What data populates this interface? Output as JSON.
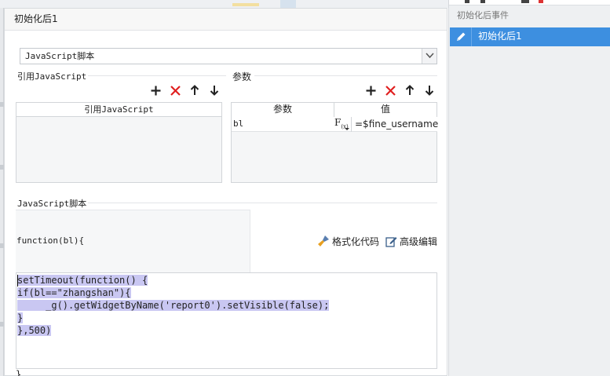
{
  "dialog": {
    "title": "初始化后1",
    "script_type": "JavaScript脚本"
  },
  "ref_js": {
    "section_label": "引用JavaScript",
    "column_header": "引用JavaScript",
    "toolbar": {
      "add": "add-icon",
      "delete": "delete-icon",
      "up": "arrow-up-icon",
      "down": "arrow-down-icon"
    }
  },
  "params": {
    "section_label": "参数",
    "columns": [
      "参数",
      "值"
    ],
    "rows": [
      {
        "name": "bl",
        "formula_button": "F(x)",
        "value": "=$fine_username"
      }
    ]
  },
  "script": {
    "section_label": "JavaScript脚本",
    "signature": "function(bl){",
    "format_label": "格式化代码",
    "advanced_label": "高级编辑",
    "code_lines": [
      "setTimeout(function() {",
      "if(bl==\"zhangshan\"){",
      "     _g().getWidgetByName('report0').setVisible(false);",
      "}",
      "},500)"
    ],
    "closing_brace": "}"
  },
  "event_panel": {
    "header": "初始化后事件",
    "items": [
      {
        "label": "初始化后1",
        "selected": true
      }
    ]
  },
  "colors": {
    "accent": "#3d8fe0",
    "delete_red": "#e02020",
    "code_highlight": "#c9c7f2",
    "keyword": "#7f1ca8",
    "string": "#b0149a"
  }
}
